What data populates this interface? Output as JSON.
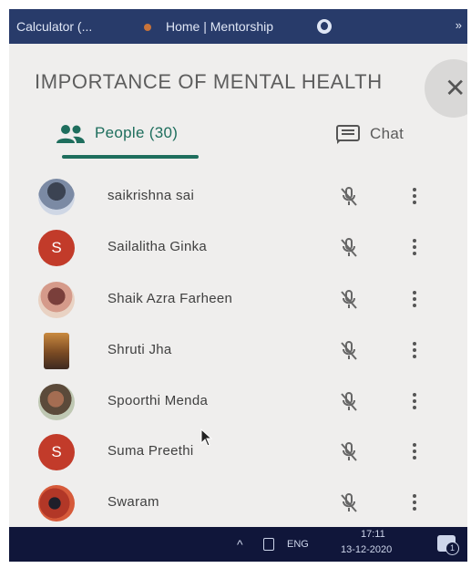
{
  "browser": {
    "bookmarks": [
      {
        "label": "Calculator (..."
      },
      {
        "label": "Home | Mentorship"
      }
    ],
    "more_label": "»"
  },
  "panel": {
    "title": "IMPORTANCE OF MENTAL HEALTH",
    "close_icon": "close-icon",
    "tabs": {
      "people": {
        "label": "People (30)",
        "active": true,
        "accent": "#1e6e5d"
      },
      "chat": {
        "label": "Chat",
        "active": false
      }
    },
    "participants": [
      {
        "name": "saikrishna sai",
        "avatar_type": "photo",
        "mic": "muted"
      },
      {
        "name": "Sailalitha Ginka",
        "avatar_type": "letter",
        "avatar_letter": "S",
        "mic": "muted"
      },
      {
        "name": "Shaik Azra Farheen",
        "avatar_type": "photo",
        "mic": "muted"
      },
      {
        "name": "Shruti Jha",
        "avatar_type": "photo",
        "mic": "muted"
      },
      {
        "name": "Spoorthi Menda",
        "avatar_type": "photo",
        "mic": "muted"
      },
      {
        "name": "Suma Preethi",
        "avatar_type": "letter",
        "avatar_letter": "S",
        "mic": "muted"
      },
      {
        "name": "Swaram",
        "avatar_type": "photo",
        "mic": "muted"
      }
    ]
  },
  "taskbar": {
    "language": "ENG",
    "time": "17:11",
    "date": "13-12-2020",
    "notification_count": "1"
  }
}
